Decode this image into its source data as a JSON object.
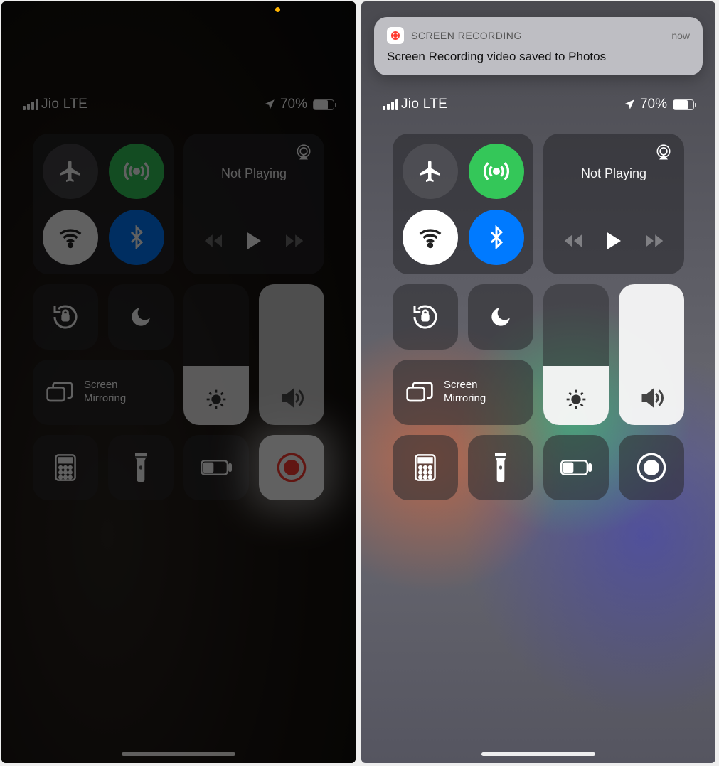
{
  "status": {
    "carrier": "Jio LTE",
    "battery_pct": "70%"
  },
  "media": {
    "not_playing": "Not Playing"
  },
  "mirror": {
    "label_line1": "Screen",
    "label_line2": "Mirroring"
  },
  "notification": {
    "app": "SCREEN RECORDING",
    "time": "now",
    "body": "Screen Recording video saved to Photos"
  },
  "brightness": {
    "pct": 42
  },
  "volume": {
    "pct": 100
  },
  "colors": {
    "green": "#34c759",
    "blue": "#007aff",
    "red": "#ff3b30"
  }
}
